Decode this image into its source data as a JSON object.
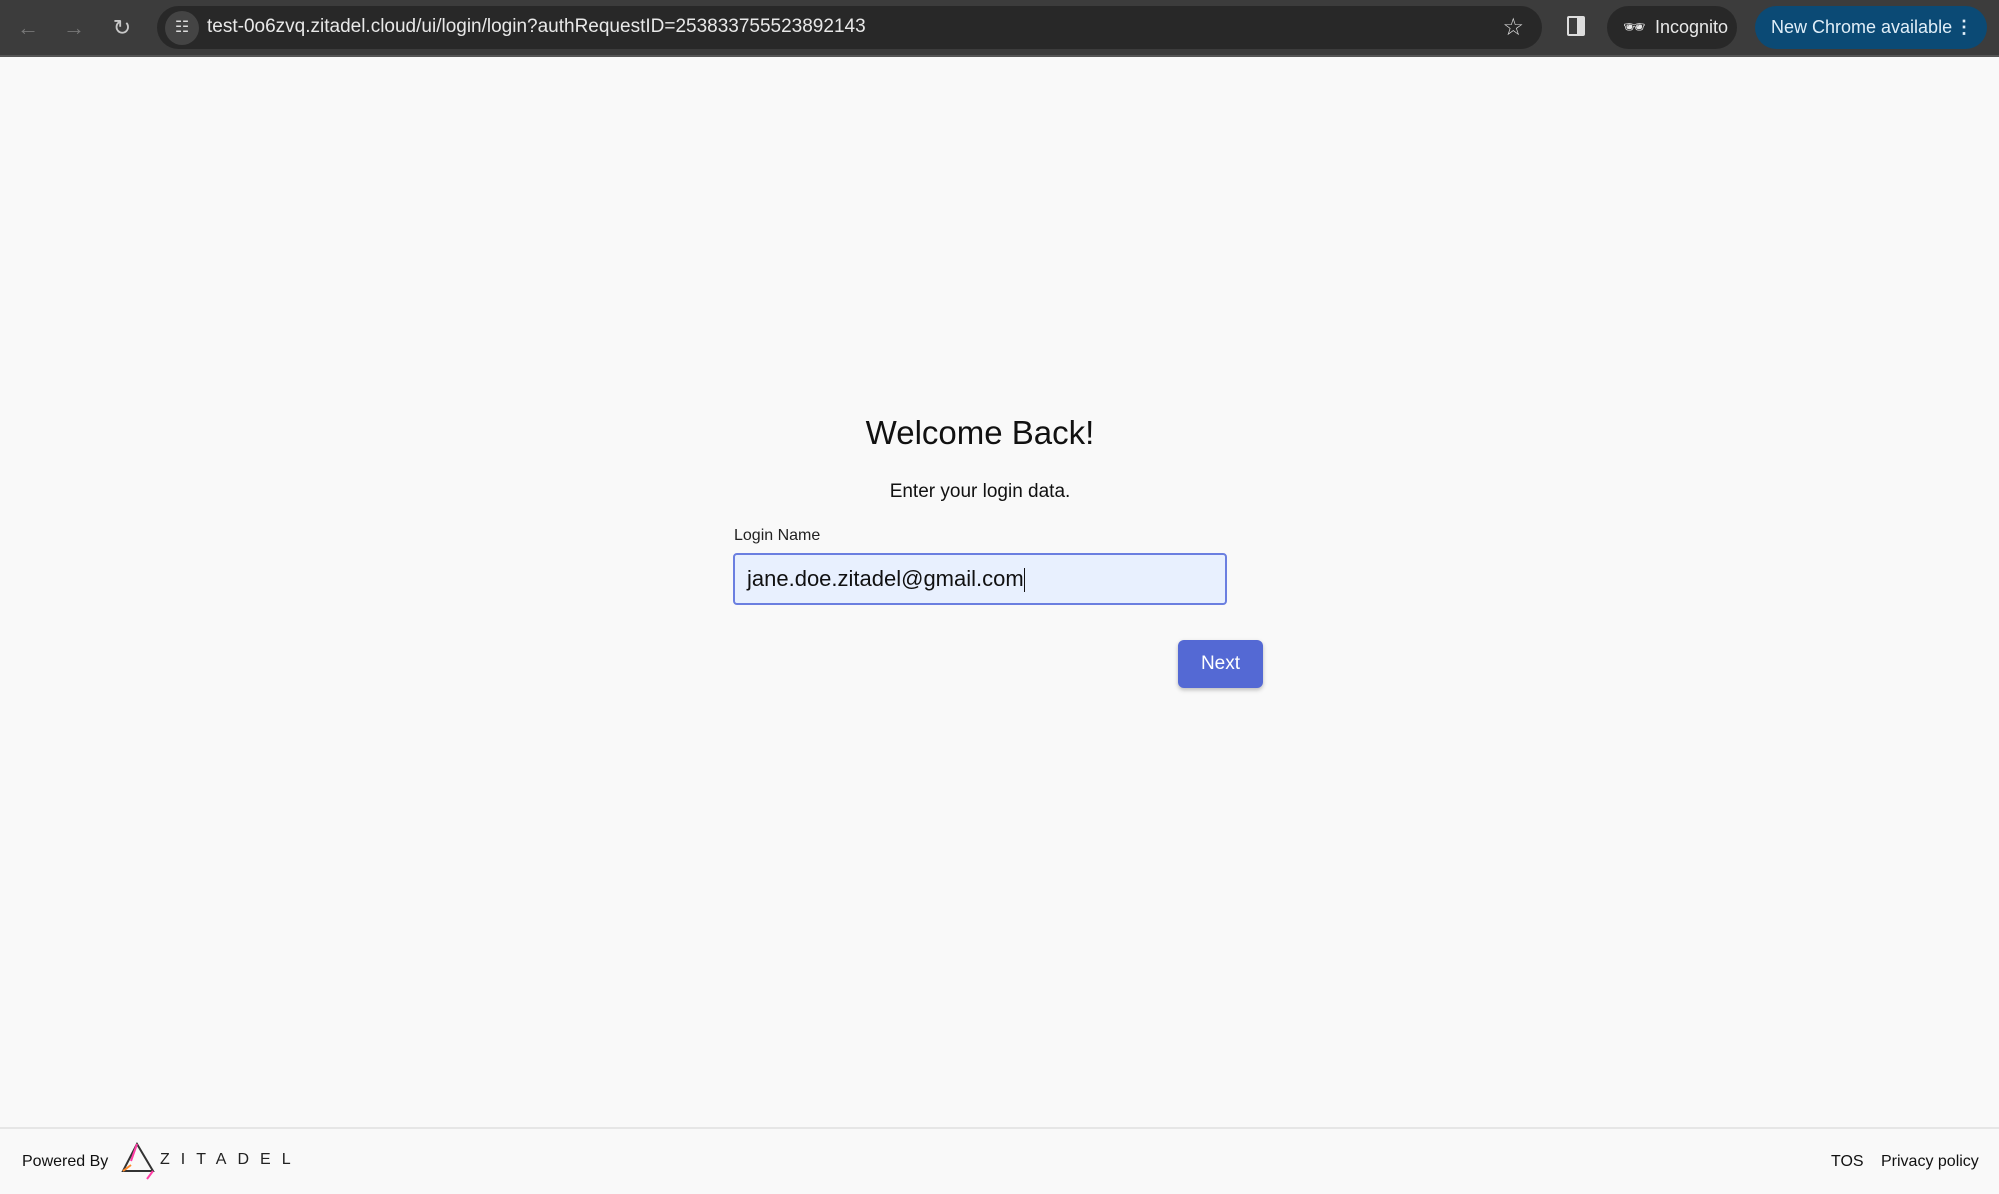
{
  "browser": {
    "url": "test-0o6zvq.zitadel.cloud/ui/login/login?authRequestID=253833755523892143",
    "incognito_label": "Incognito",
    "update_label": "New Chrome available"
  },
  "login": {
    "title": "Welcome Back!",
    "subtitle": "Enter your login data.",
    "field_label": "Login Name",
    "field_value": "jane.doe.zitadel@gmail.com",
    "next_label": "Next"
  },
  "footer": {
    "powered_by": "Powered By",
    "brand": "ZITADEL",
    "tos": "TOS",
    "privacy": "Privacy policy"
  },
  "colors": {
    "accent": "#5469d4",
    "input_bg": "#e8f0fe",
    "update_bg": "#0b4a75"
  }
}
